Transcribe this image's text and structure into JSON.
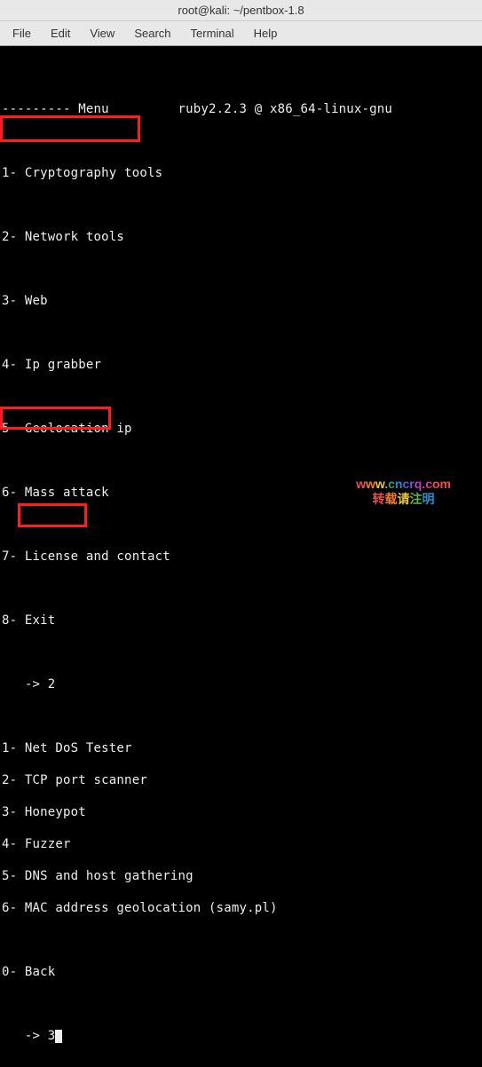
{
  "titlebar": {
    "text": "root@kali: ~/pentbox-1.8"
  },
  "menubar": {
    "file": "File",
    "edit": "Edit",
    "view": "View",
    "search": "Search",
    "terminal": "Terminal",
    "help": "Help"
  },
  "terminal": {
    "blank": "",
    "menu_header": "--------- Menu         ruby2.2.3 @ x86_64-linux-gnu",
    "menu1": "1- Cryptography tools",
    "menu2": "2- Network tools",
    "menu3": "3- Web",
    "menu4": "4- Ip grabber",
    "menu5": "5- Geolocation ip",
    "menu6": "6- Mass attack",
    "menu7": "7- License and contact",
    "menu8": "8- Exit",
    "prompt1": "   -> 2",
    "sub1": "1- Net DoS Tester",
    "sub2": "2- TCP port scanner",
    "sub3": "3- Honeypot",
    "sub4": "4- Fuzzer",
    "sub5": "5- DNS and host gathering",
    "sub6": "6- MAC address geolocation (samy.pl)",
    "sub0": "0- Back",
    "prompt2_pre": "   -> 3"
  },
  "watermark": {
    "line1": [
      "w",
      "w",
      "w",
      ".",
      "c",
      "n",
      "c",
      "r",
      "q",
      ".",
      "c",
      "o",
      "m"
    ],
    "line2": [
      "转",
      "载",
      "请",
      "注",
      "明",
      " "
    ]
  }
}
